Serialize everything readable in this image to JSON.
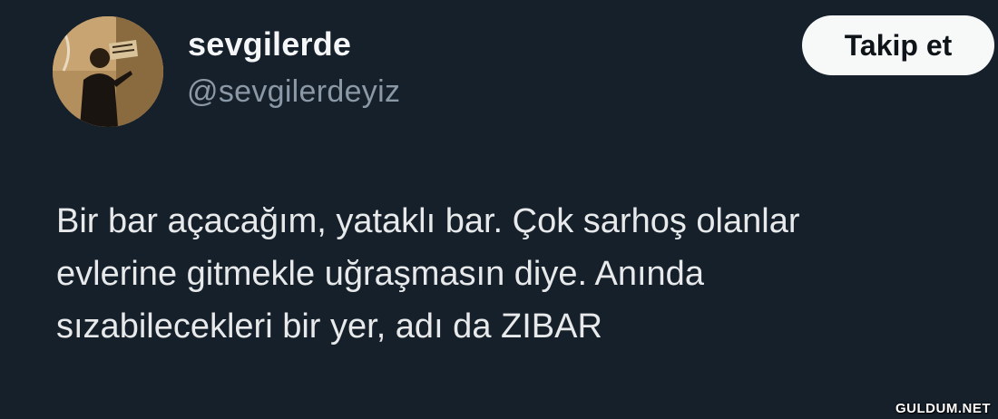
{
  "tweet": {
    "display_name": "sevgilerde",
    "handle": "@sevgilerdeyiz",
    "follow_label": "Takip et",
    "text_lines": [
      "Bir bar açacağım, yataklı bar. Çok sarhoş olanlar",
      "evlerine gitmekle uğraşmasın diye. Anında",
      "sızabilecekleri bir yer, adı da ZIBAR"
    ]
  },
  "watermark": "GULDUM.NET",
  "colors": {
    "background": "#15202b",
    "text": "#e7e9ea",
    "secondary_text": "#8b98a5",
    "button_bg": "#f7f9f9",
    "button_text": "#0f1419"
  },
  "icons": {
    "avatar": "profile-photo"
  }
}
